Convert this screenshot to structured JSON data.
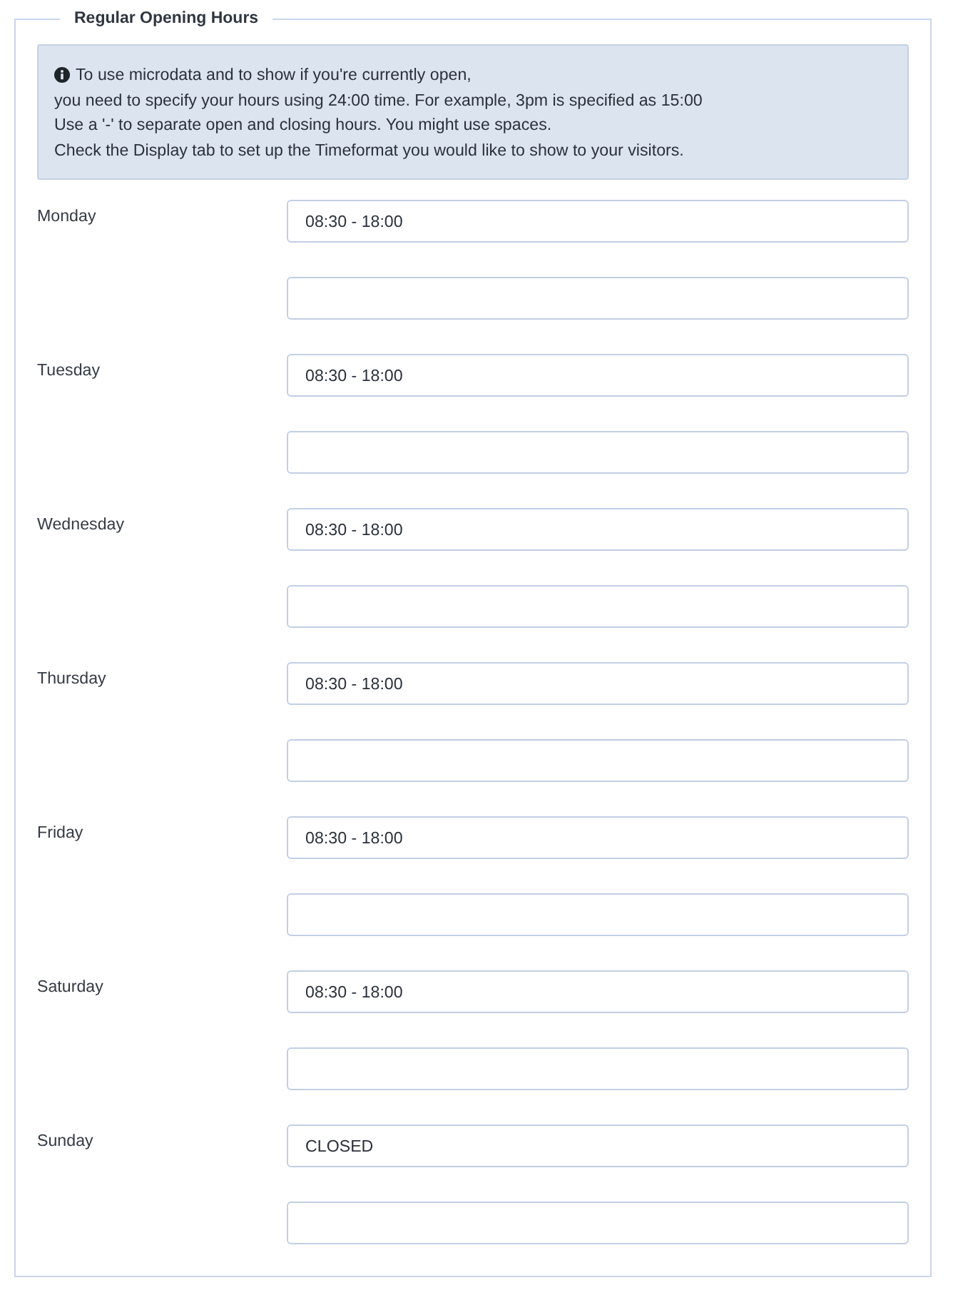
{
  "section": {
    "title": "Regular Opening Hours"
  },
  "info": {
    "lines": [
      "To use microdata and to show if you're currently open,",
      "you need to specify your hours using 24:00 time. For example, 3pm is specified as 15:00",
      "Use a '-' to separate open and closing hours. You might use spaces.",
      "Check the Display tab to set up the Timeformat you would like to show to your visitors."
    ]
  },
  "days": [
    {
      "name": "Monday",
      "hours": "08:30 - 18:00"
    },
    {
      "name": "Tuesday",
      "hours": "08:30 - 18:00"
    },
    {
      "name": "Wednesday",
      "hours": "08:30 - 18:00"
    },
    {
      "name": "Thursday",
      "hours": "08:30 - 18:00"
    },
    {
      "name": "Friday",
      "hours": "08:30 - 18:00"
    },
    {
      "name": "Saturday",
      "hours": "08:30 - 18:00"
    },
    {
      "name": "Sunday",
      "hours": "CLOSED"
    }
  ]
}
